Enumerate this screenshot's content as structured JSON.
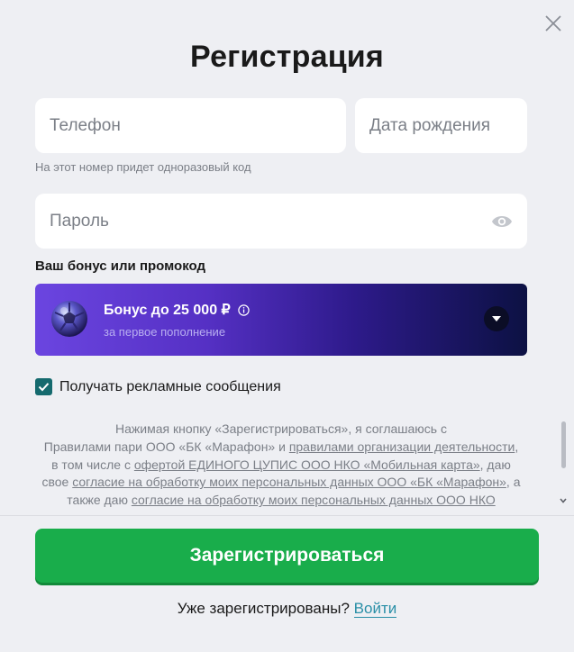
{
  "modal": {
    "title": "Регистрация",
    "close_icon": "close-icon"
  },
  "form": {
    "phone_placeholder": "Телефон",
    "dob_placeholder": "Дата рождения",
    "phone_hint": "На этот номер придет одноразовый код",
    "password_placeholder": "Пароль",
    "password_icon": "eye-icon"
  },
  "bonus": {
    "heading": "Ваш бонус или промокод",
    "title": "Бонус до 25 000 ₽",
    "subtitle": "за первое пополнение",
    "icon": "soccer-ball-icon",
    "info_icon": "info-icon",
    "dropdown_icon": "chevron-down-icon"
  },
  "marketing": {
    "checked": true,
    "label": "Получать рекламные сообщения"
  },
  "terms": {
    "t1": "Нажимая кнопку «Зарегистрироваться», я соглашаюсь с",
    "t2": "Правилами пари ООО «БК «Марафон» и ",
    "link_rules": "правилами организации деятельности",
    "t3": ",",
    "t4": "в том числе с ",
    "link_offer": "офертой ЕДИНОГО ЦУПИС ООО НКО «Мобильная карта»",
    "t5": ", даю",
    "t6": "свое ",
    "link_consent1": "согласие на обработку моих персональных данных ООО «БК «Марафон»",
    "t7": ", а",
    "t8": "также даю ",
    "link_consent2": "согласие на обработку моих персональных данных ООО НКО"
  },
  "actions": {
    "register_label": "Зарегистрироваться",
    "already_registered": "Уже зарегистрированы?",
    "login_label": "Войти"
  },
  "colors": {
    "background": "#eeeff3",
    "primary_button": "#19ad4b",
    "checkbox": "#156a6e",
    "link": "#2a8fa7"
  }
}
